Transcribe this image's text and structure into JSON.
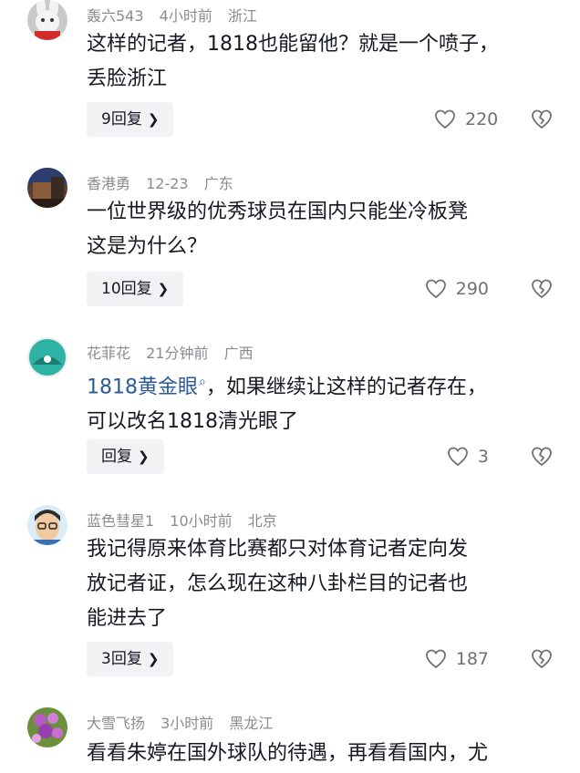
{
  "comments": [
    {
      "user": "轰六543",
      "time": "4小时前",
      "location": "浙江",
      "text_lines": [
        "这样的记者，1818也能留他？就是一个喷子，",
        "丢脸浙江"
      ],
      "reply_label": "9回复",
      "likes": "220",
      "avatar": "rabbit-avatar"
    },
    {
      "user": "香港勇",
      "time": "12-23",
      "location": "广东",
      "text_lines": [
        "一位世界级的优秀球员在国内只能坐冷板凳",
        "这是为什么？"
      ],
      "reply_label": "10回复",
      "likes": "290",
      "avatar": "room-avatar"
    },
    {
      "user": "花菲花",
      "time": "21分钟前",
      "location": "广西",
      "mention": "1818黄金眼",
      "text_lines": [
        "，如果继续让这样的记者存在，",
        "可以改名1818清光眼了"
      ],
      "reply_label": "回复",
      "likes": "3",
      "avatar": "teal-avatar"
    },
    {
      "user": "蓝色彗星1",
      "time": "10小时前",
      "location": "北京",
      "text_lines": [
        "我记得原来体育比赛都只对体育记者定向发",
        "放记者证，怎么现在这种八卦栏目的记者也",
        "能进去了"
      ],
      "reply_label": "3回复",
      "likes": "187",
      "avatar": "cartoon-avatar"
    },
    {
      "user": "大雪飞扬",
      "time": "3小时前",
      "location": "黑龙江",
      "text_lines": [
        "看看朱婷在国外球队的待遇，再看看国内，尤"
      ],
      "avatar": "flower-avatar"
    }
  ],
  "colors": {
    "meta": "#8a8b91",
    "mention": "#2b5a99",
    "reply_bg": "#f2f2f4"
  }
}
